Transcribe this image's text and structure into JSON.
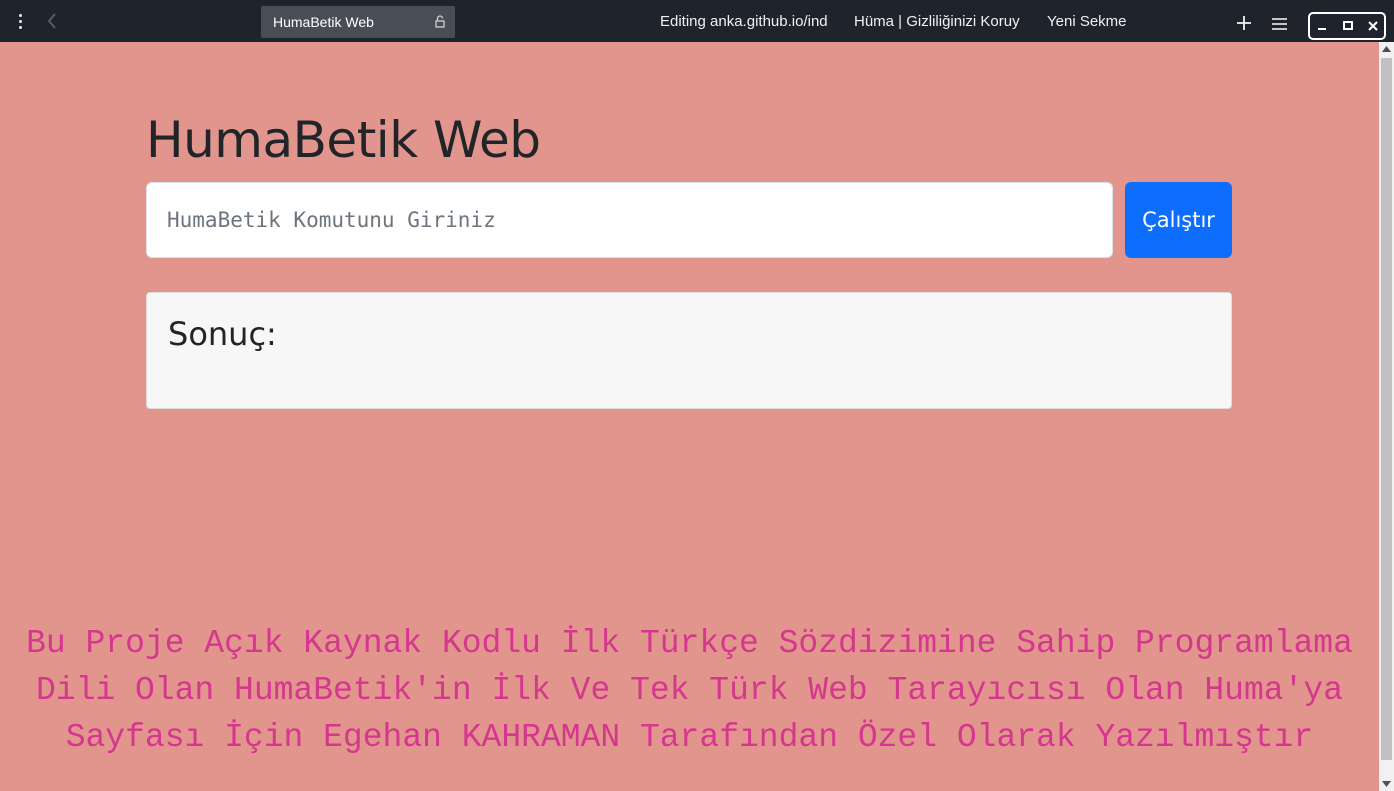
{
  "browser": {
    "active_tab": {
      "title": "HumaBetik Web",
      "icon": "lock-icon"
    },
    "tabs": [
      {
        "title": "Editing anka.github.io/ind"
      },
      {
        "title": "Hüma | Gizliliğinizi Koruy"
      },
      {
        "title": "Yeni Sekme"
      }
    ],
    "icons": {
      "menu": "vertical-dots-icon",
      "back": "chevron-left-icon",
      "new_tab": "plus-icon",
      "tab_list": "hamburger-icon",
      "minimize": "minimize-icon",
      "maximize": "maximize-icon",
      "close": "close-icon"
    }
  },
  "page": {
    "title": "HumaBetik Web",
    "command_input": {
      "value": "",
      "placeholder": "HumaBetik Komutunu Giriniz"
    },
    "run_button_label": "Çalıştır",
    "result_label": "Sonuç:",
    "footer_text": "Bu Proje Açık Kaynak Kodlu İlk Türkçe Sözdizimine Sahip Programlama Dili Olan HumaBetik'in İlk Ve Tek Türk Web Tarayıcısı Olan Huma'ya Sayfası İçin Egehan KAHRAMAN Tarafından Özel Olarak Yazılmıştır"
  },
  "colors": {
    "page_background": "#e1958d",
    "topbar_background": "#1f232b",
    "primary_button": "#0d6efd",
    "footer_text": "#d6378e"
  }
}
